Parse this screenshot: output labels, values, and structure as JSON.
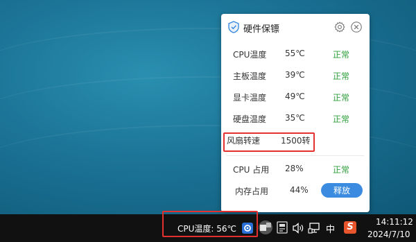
{
  "popup": {
    "title": "硬件保镖",
    "rows": [
      {
        "label": "CPU温度",
        "value": "55℃",
        "status": "正常"
      },
      {
        "label": "主板温度",
        "value": "39℃",
        "status": "正常"
      },
      {
        "label": "显卡温度",
        "value": "49℃",
        "status": "正常"
      },
      {
        "label": "硬盘温度",
        "value": "35℃",
        "status": "正常"
      },
      {
        "label": "风扇转速",
        "value": "1500转"
      }
    ],
    "usage": [
      {
        "label": "CPU 占用",
        "value": "28%",
        "status": "正常"
      },
      {
        "label": "内存占用",
        "value": "44%"
      }
    ],
    "release_label": "释放"
  },
  "taskbar": {
    "cpu_temp": "CPU温度: 56℃",
    "ime": "中",
    "sogou": "S",
    "time": "14:11:12",
    "date": "2024/7/10"
  },
  "colors": {
    "status_ok": "#2e9e3a",
    "accent": "#3b8be0",
    "highlight": "#e53030"
  }
}
